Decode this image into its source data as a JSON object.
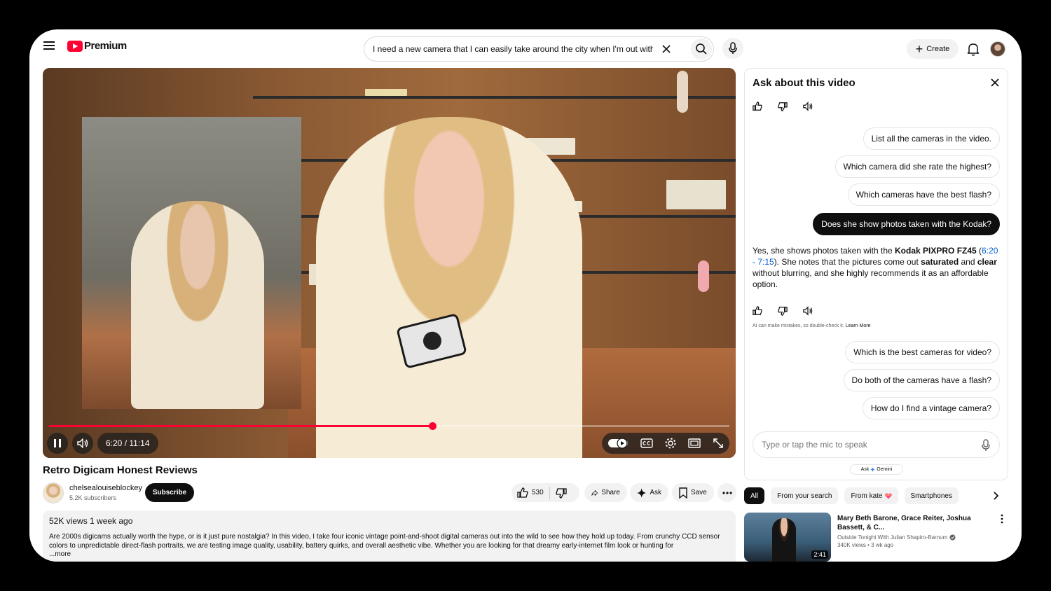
{
  "header": {
    "logo_text": "Premium",
    "search_value": "I need a new camera that I can easily take around the city when I'm out with",
    "create_label": "Create"
  },
  "player": {
    "current_time": "6:20",
    "time_separator": "/",
    "duration": "11:14",
    "progress_fraction": 0.5638
  },
  "video": {
    "title": "Retro Digicam Honest Reviews",
    "channel_name": "chelsealouiseblockey",
    "subscribers": "5.2K subscribers",
    "subscribe_label": "Subscribe",
    "likes": "530",
    "share_label": "Share",
    "ask_label": "Ask",
    "save_label": "Save",
    "views_meta": "52K views  1 week ago",
    "description": "Are 2000s digicams actually worth the hype, or is it just pure nostalgia? In this video, I take four iconic vintage point-and-shoot digital cameras out into the wild to see how they hold up today. From crunchy CCD sensor colors to unpredictable direct-flash portraits, we are testing image quality, usability, battery quirks, and overall aesthetic vibe. Whether you are looking for that dreamy early-internet film look or hunting for",
    "more_label": "...more"
  },
  "ask_panel": {
    "title": "Ask about this video",
    "suggestions_top": [
      "List all the cameras in the video.",
      "Which camera did she rate the highest?",
      "Which cameras have the best flash?"
    ],
    "user_question": "Does she show photos taken with the Kodak?",
    "answer": {
      "part1": "Yes, she shows photos taken with the ",
      "bold1": "Kodak PIXPRO FZ45",
      "part2": " (",
      "timestamp": "6:20 - 7:15",
      "part3": "). She notes that the pictures come out ",
      "bold2": "saturated",
      "part4": " and ",
      "bold3": "clear",
      "part5": " without blurring, and she highly recommends it as an affordable option."
    },
    "disclaimer": "AI can make mistakes, so double-check it.",
    "learn_more": "Learn More",
    "suggestions_bottom": [
      "Which is the best cameras for video?",
      "Do both of the cameras have a flash?",
      "How do I find a vintage camera?"
    ],
    "input_placeholder": "Type or tap the mic to speak",
    "gemini_prefix": "Ask",
    "gemini_name": "Gemini"
  },
  "filters": [
    "All",
    "From your search",
    "From kate",
    "Smartphones"
  ],
  "recommendation": {
    "title": "Mary Beth Barone, Grace Reiter, Joshua Bassett, & C...",
    "channel": "Outside Tonight With Julian Shapiro-Barnum",
    "meta": "340K views • 3 wk ago",
    "duration": "2:41"
  },
  "colors": {
    "brand_red": "#ff0033",
    "link_blue": "#065fd4"
  },
  "icons": {
    "menu": "hamburger-icon",
    "search": "search-icon",
    "mic": "mic-icon",
    "bell": "bell-icon",
    "like": "thumbs-up-icon",
    "dislike": "thumbs-down-icon",
    "speaker": "speaker-icon",
    "close": "close-icon"
  }
}
